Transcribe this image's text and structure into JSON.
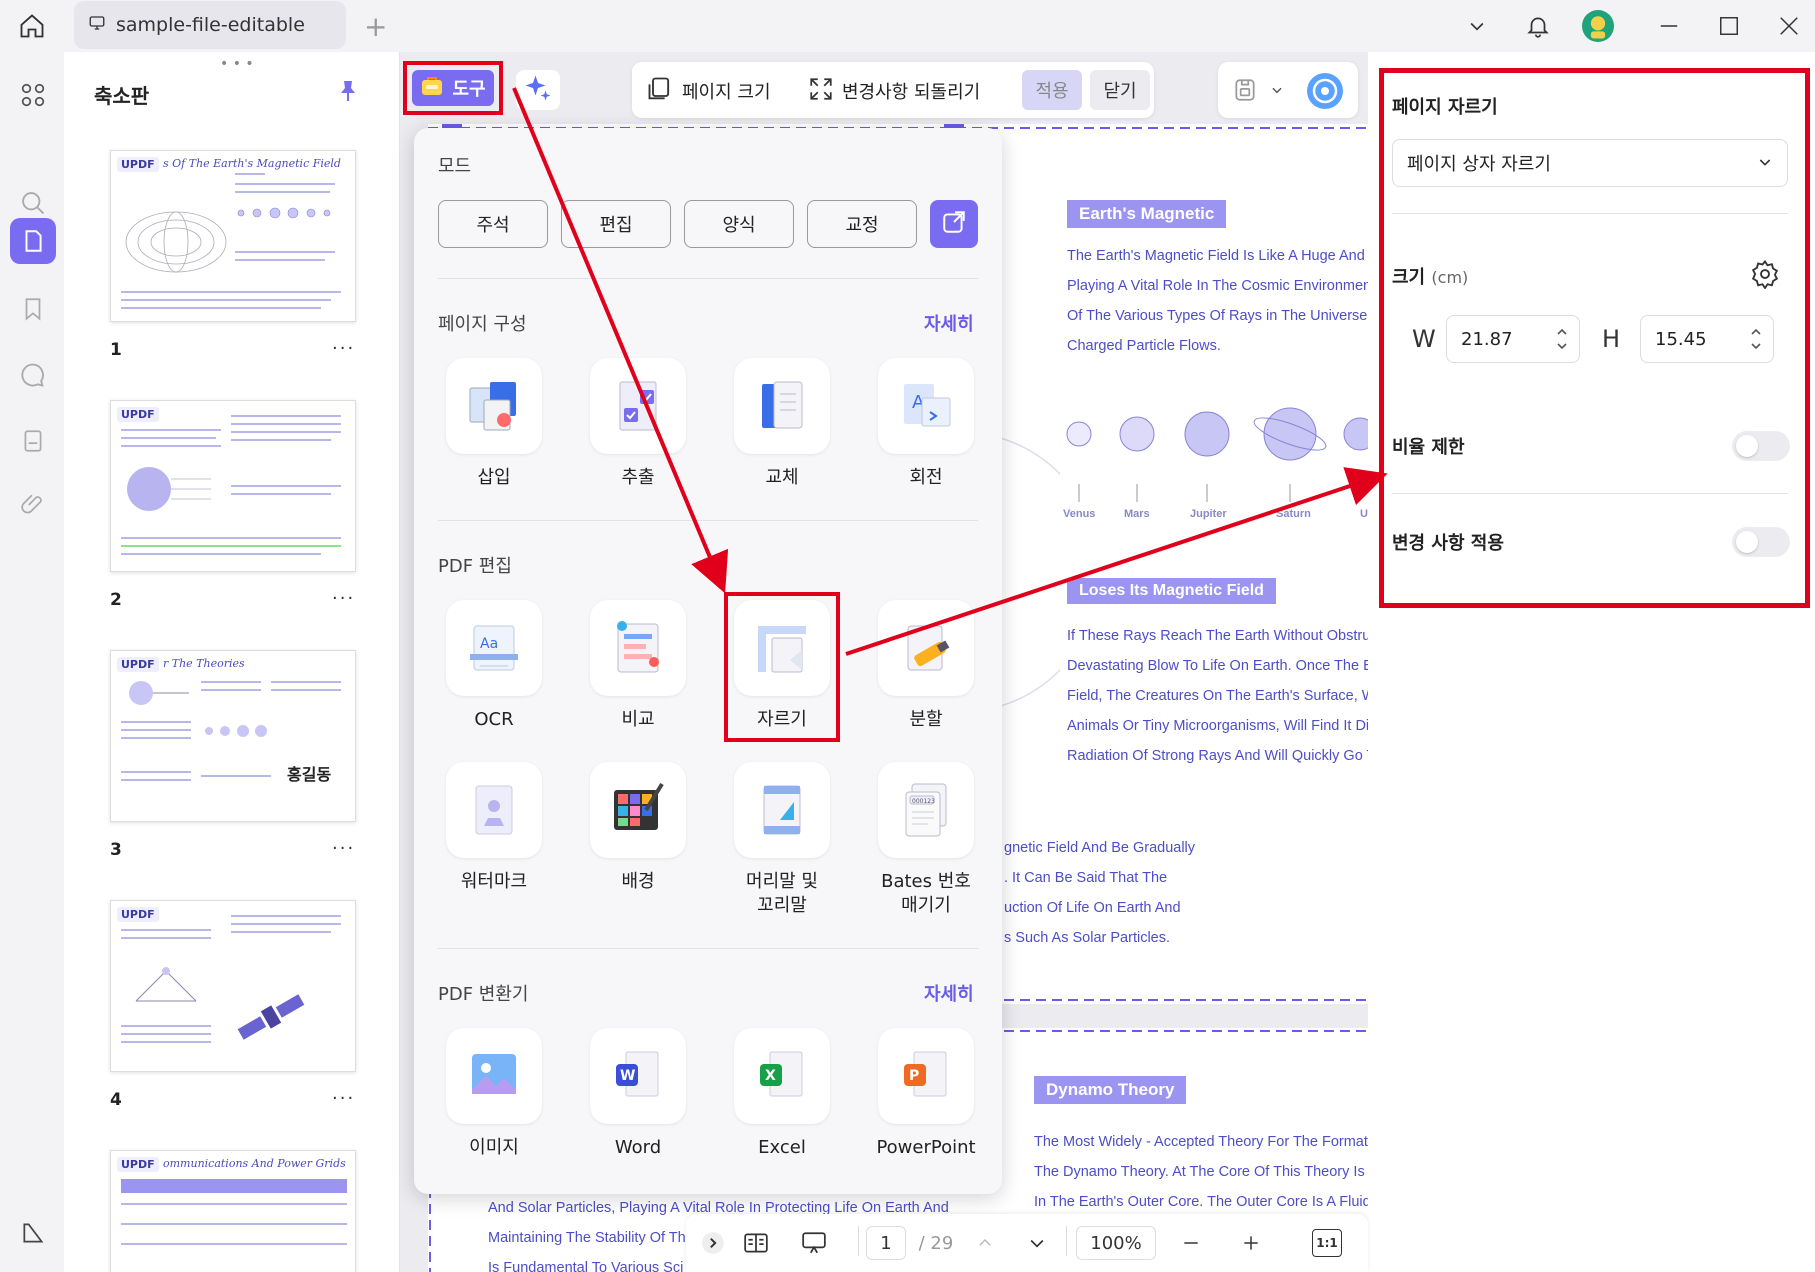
{
  "window": {
    "tab_title": "sample-file-editable"
  },
  "thumbnails": {
    "title": "축소판",
    "pages": [
      {
        "num": "1",
        "title": "s Of The Earth's Magnetic Field"
      },
      {
        "num": "2",
        "title": ""
      },
      {
        "num": "3",
        "title": "r The Theories"
      },
      {
        "num": "4",
        "title": ""
      },
      {
        "num": "",
        "title": "ommunications And Power Grids"
      }
    ],
    "logo": "UPDF",
    "more": "···"
  },
  "toolbar": {
    "tools_label": "도구",
    "page_size_label": "페이지 크기",
    "revert_label": "변경사항 되돌리기",
    "apply_label": "적용",
    "close_label": "닫기"
  },
  "tools_panel": {
    "mode_title": "모드",
    "modes": [
      "주석",
      "편집",
      "양식",
      "교정"
    ],
    "page_org_title": "페이지 구성",
    "more_label": "자세히",
    "page_tools": [
      "삽입",
      "추출",
      "교체",
      "회전"
    ],
    "pdf_edit_title": "PDF 편집",
    "edit_tools": [
      "OCR",
      "비교",
      "자르기",
      "분할"
    ],
    "edit_tools_2": [
      "워터마크",
      "배경",
      "머리말 및\n꼬리말",
      "Bates 번호\n매기기"
    ],
    "convert_title": "PDF 변환기",
    "convert_tools": [
      "이미지",
      "Word",
      "Excel",
      "PowerPoint"
    ]
  },
  "right_panel": {
    "title": "페이지 자르기",
    "select_value": "페이지 상자 자르기",
    "size_label": "크기",
    "size_unit": "(cm)",
    "w_label": "W",
    "w_value": "21.87",
    "h_label": "H",
    "h_value": "15.45",
    "ratio_label": "비율 제한",
    "ratio_on": false,
    "apply_changes_label": "변경 사항 적용",
    "apply_changes_on": false
  },
  "document": {
    "heading1": "Earth's Magnetic",
    "para1": [
      "The Earth's Magnetic Field Is Like A Huge And I",
      "Playing A Vital Role In The Cosmic Environment",
      "Of The Various Types Of Rays in The Universe,",
      "Charged Particle Flows."
    ],
    "planets": [
      "Venus",
      "Mars",
      "Jupiter",
      "Saturn",
      "U"
    ],
    "heading2": "Loses Its Magnetic Field",
    "para2": [
      "If These Rays Reach The Earth Without Obstruc",
      "Devastating Blow To Life On Earth. Once The E",
      "Field, The Creatures On The Earth's Surface, W",
      "Animals Or Tiny Microorganisms, Will Find It Dif",
      "Radiation Of Strong Rays And Will Quickly Go T"
    ],
    "para3": [
      "gnetic Field And Be Gradually",
      ". It Can Be Said That The",
      "uction Of Life On Earth And",
      "s Such As Solar Particles."
    ],
    "heading3": "Dynamo Theory",
    "para4": [
      "The Most Widely - Accepted Theory For The Formatic",
      "The Dynamo Theory. At The Core Of This Theory Is T",
      "In The Earth's Outer Core. The Outer Core Is A Fluid"
    ],
    "para5": [
      "And Solar Particles, Playing A Vital Role In Protecting Life On Earth And",
      "Maintaining The Stability Of Th",
      "Is Fundamental To Various Sci"
    ]
  },
  "bottom_bar": {
    "page_current": "1",
    "page_total": "/ 29",
    "zoom": "100%",
    "fit_label": "1:1"
  },
  "colors": {
    "accent": "#7a6cf0",
    "highlight": "#e0001b"
  }
}
